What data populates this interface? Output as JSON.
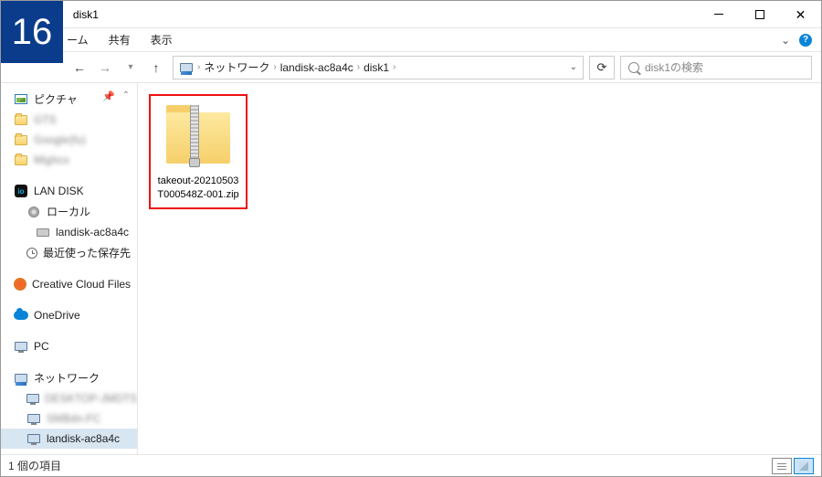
{
  "overlay_number": "16",
  "title": "disk1",
  "ribbon": {
    "tab_home_suffix": "ーム",
    "tab_share": "共有",
    "tab_view": "表示"
  },
  "breadcrumbs": {
    "c0": "ネットワーク",
    "c1": "landisk-ac8a4c",
    "c2": "disk1"
  },
  "search_placeholder": "disk1の検索",
  "nav": {
    "pictures": "ピクチャ",
    "blur1": "GTS",
    "blur2": "Google(fu)",
    "blur3": "Mighco",
    "landisk": "LAN DISK",
    "local": "ローカル",
    "landisk_host": "landisk-ac8a4c",
    "recent": "最近使った保存先",
    "cc": "Creative Cloud Files",
    "onedrive": "OneDrive",
    "pc": "PC",
    "network": "ネットワーク",
    "net_blur1": "DESKTOP-JMDTS",
    "net_blur2": "SMBdn-FC",
    "net_host": "landisk-ac8a4c"
  },
  "file_name": "takeout-20210503T000548Z-001.zip",
  "status_text": "1 個の項目"
}
